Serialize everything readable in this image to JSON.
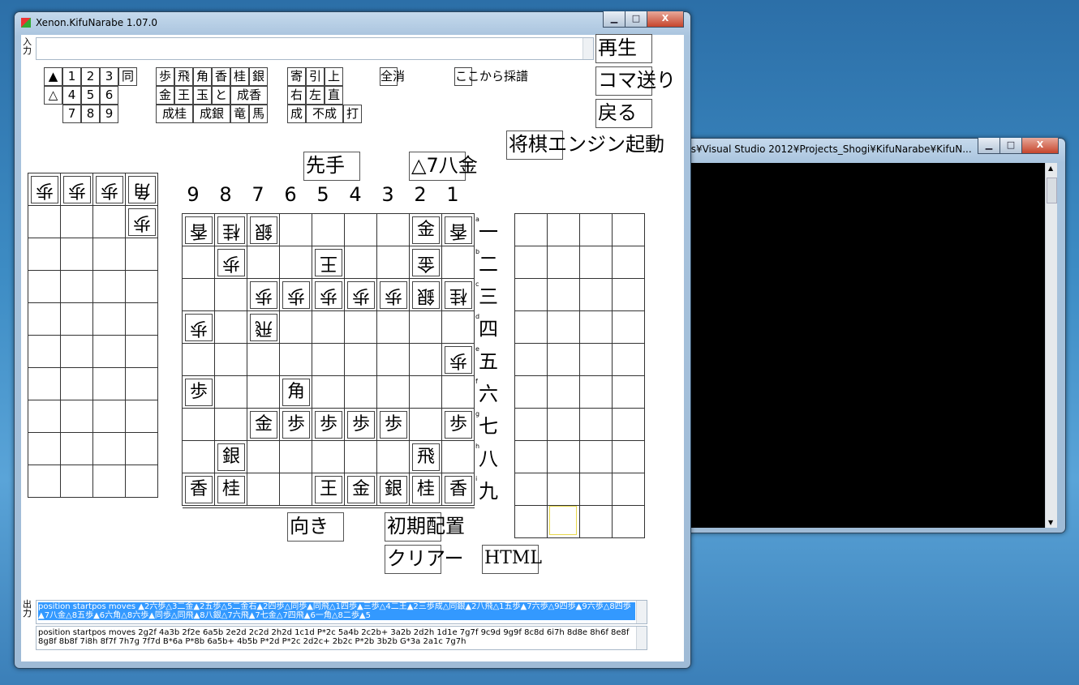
{
  "console": {
    "title": "ts¥Visual Studio 2012¥Projects_Shogi¥KifuNarabe¥KifuN...",
    "buttons": {
      "min": "▁",
      "max": "□",
      "close": "X"
    }
  },
  "window": {
    "title": "Xenon.KifuNarabe 1.07.0",
    "buttons": {
      "min": "▁",
      "max": "□",
      "close": "X"
    }
  },
  "input_label": "入力",
  "output_label": "出力",
  "right_buttons": {
    "play": "再生",
    "step": "コマ送り",
    "back": "戻る",
    "engine": "将棋エンジン起動"
  },
  "sente_label": "先手",
  "last_move": "△7八金",
  "keypad": {
    "row1": [
      "▲",
      "1",
      "2",
      "3",
      "同"
    ],
    "row2": [
      "△",
      "4",
      "5",
      "6"
    ],
    "row3": [
      "7",
      "8",
      "9"
    ]
  },
  "piece_buttons": {
    "row1": [
      "歩",
      "飛",
      "角",
      "香",
      "桂",
      "銀"
    ],
    "row2": [
      "金",
      "王",
      "玉",
      "と",
      "成香"
    ],
    "row3": [
      "成桂",
      "成銀",
      "竜",
      "馬"
    ]
  },
  "modifier_buttons": {
    "row1": [
      "寄",
      "引",
      "上"
    ],
    "row2": [
      "右",
      "左",
      "直"
    ],
    "row3": [
      "成",
      "不成",
      "打"
    ]
  },
  "clear_all": "全消",
  "record_from_here": "ここから採譜",
  "col_numbers": [
    "9",
    "8",
    "7",
    "6",
    "5",
    "4",
    "3",
    "2",
    "1"
  ],
  "row_numbers": [
    "一",
    "二",
    "三",
    "四",
    "五",
    "六",
    "七",
    "八",
    "九"
  ],
  "row_letters": [
    "a",
    "b",
    "c",
    "d",
    "e",
    "f",
    "g",
    "h",
    "i"
  ],
  "board": [
    {
      "c": 0,
      "r": 0,
      "p": "香",
      "g": true
    },
    {
      "c": 1,
      "r": 0,
      "p": "桂",
      "g": true
    },
    {
      "c": 2,
      "r": 0,
      "p": "銀",
      "g": true
    },
    {
      "c": 7,
      "r": 0,
      "p": "金",
      "g": false
    },
    {
      "c": 8,
      "r": 0,
      "p": "香",
      "g": true
    },
    {
      "c": 1,
      "r": 1,
      "p": "歩",
      "g": true
    },
    {
      "c": 4,
      "r": 1,
      "p": "王",
      "g": true
    },
    {
      "c": 7,
      "r": 1,
      "p": "金",
      "g": true
    },
    {
      "c": 2,
      "r": 2,
      "p": "歩",
      "g": true
    },
    {
      "c": 3,
      "r": 2,
      "p": "歩",
      "g": true
    },
    {
      "c": 4,
      "r": 2,
      "p": "歩",
      "g": true
    },
    {
      "c": 5,
      "r": 2,
      "p": "歩",
      "g": true
    },
    {
      "c": 6,
      "r": 2,
      "p": "歩",
      "g": true
    },
    {
      "c": 7,
      "r": 2,
      "p": "銀",
      "g": true
    },
    {
      "c": 8,
      "r": 2,
      "p": "桂",
      "g": true
    },
    {
      "c": 0,
      "r": 3,
      "p": "歩",
      "g": true
    },
    {
      "c": 2,
      "r": 3,
      "p": "飛",
      "g": true
    },
    {
      "c": 8,
      "r": 4,
      "p": "歩",
      "g": true
    },
    {
      "c": 0,
      "r": 5,
      "p": "歩",
      "g": false
    },
    {
      "c": 3,
      "r": 5,
      "p": "角",
      "g": false
    },
    {
      "c": 2,
      "r": 6,
      "p": "金",
      "g": false
    },
    {
      "c": 3,
      "r": 6,
      "p": "歩",
      "g": false
    },
    {
      "c": 4,
      "r": 6,
      "p": "歩",
      "g": false
    },
    {
      "c": 5,
      "r": 6,
      "p": "歩",
      "g": false
    },
    {
      "c": 6,
      "r": 6,
      "p": "歩",
      "g": false
    },
    {
      "c": 8,
      "r": 6,
      "p": "歩",
      "g": false
    },
    {
      "c": 1,
      "r": 7,
      "p": "銀",
      "g": false
    },
    {
      "c": 7,
      "r": 7,
      "p": "飛",
      "g": false
    },
    {
      "c": 0,
      "r": 8,
      "p": "香",
      "g": false
    },
    {
      "c": 1,
      "r": 8,
      "p": "桂",
      "g": false
    },
    {
      "c": 4,
      "r": 8,
      "p": "王",
      "g": false
    },
    {
      "c": 5,
      "r": 8,
      "p": "金",
      "g": false
    },
    {
      "c": 6,
      "r": 8,
      "p": "銀",
      "g": false
    },
    {
      "c": 7,
      "r": 8,
      "p": "桂",
      "g": false
    },
    {
      "c": 8,
      "r": 8,
      "p": "香",
      "g": false
    }
  ],
  "gote_hand": [
    {
      "c": 0,
      "r": 0,
      "p": "歩"
    },
    {
      "c": 1,
      "r": 0,
      "p": "歩"
    },
    {
      "c": 2,
      "r": 0,
      "p": "歩"
    },
    {
      "c": 3,
      "r": 0,
      "p": "角"
    },
    {
      "c": 3,
      "r": 1,
      "p": "歩"
    }
  ],
  "bottom_buttons": {
    "orientation": "向き",
    "initial": "初期配置",
    "clear": "クリアー",
    "html": "HTML"
  },
  "output1": "position startpos moves ▲2六歩△3二金▲2五歩△5二金右▲2四歩△同歩▲同飛△1四歩▲三歩△4二王▲2三歩成△同銀▲2八飛△1五歩▲7六歩△9四歩▲9六歩△8四歩▲7八金△8五歩▲6六角△8六歩▲同歩△同飛▲8八銀△7六飛▲7七金△7四飛▲6一角△8二歩▲5",
  "output2": "position startpos moves 2g2f 4a3b 2f2e 6a5b 2e2d 2c2d 2h2d 1c1d P*2c 5a4b 2c2b+ 3a2b 2d2h 1d1e 7g7f 9c9d 9g9f 8c8d 6i7h 8d8e 8h6f 8e8f 8g8f 8b8f 7i8h 8f7f 7h7g 7f7d B*6a P*8b 6a5b+ 4b5b P*2d P*2c 2d2c+ 2b2c P*2b 3b2b G*3a 2a1c 7g7h"
}
